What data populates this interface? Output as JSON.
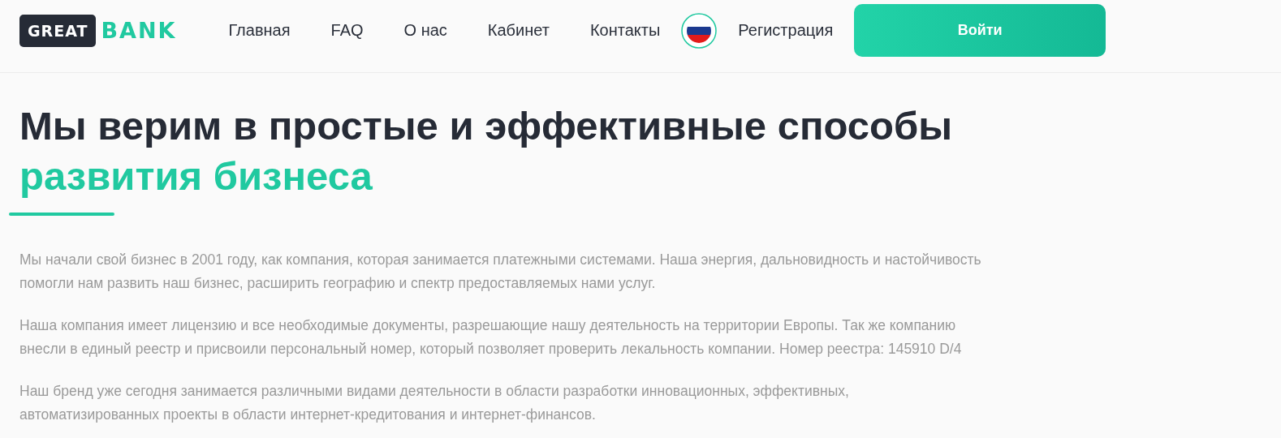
{
  "logo": {
    "part_1": "GREAT",
    "part_2": "BANK"
  },
  "nav": [
    {
      "label": "Главная"
    },
    {
      "label": "FAQ"
    },
    {
      "label": "О нас"
    },
    {
      "label": "Кабинет"
    },
    {
      "label": "Контакты"
    }
  ],
  "register": "Регистрация",
  "login_button": "Войти",
  "heading": {
    "line_1": "Мы верим в простые и эффективные способы",
    "line_2": "развития бизнеса"
  },
  "paragraphs": [
    {
      "lines": [
        "Мы начали свой бизнес в 2001 году, как компания, которая занимается платежными системами. Наша энергия, дальновидность и настойчивость",
        "помогли нам развить наш бизнес, расширить географию и спектр предоставляемых нами услуг."
      ]
    },
    {
      "lines": [
        "Наша компания имеет лицензию и все необходимые документы, разрешающие нашу деятельность на территории Европы. Так же компанию",
        "внесли в единый реестр и присвоили персональный номер, который позволяет проверить лекальность компании. Номер реестра: 145910 D/4"
      ]
    },
    {
      "lines": [
        "Наш бренд уже сегодня занимается различными видами деятельности в области разработки инновационных, эффективных,",
        "автоматизированных проекты в области интернет-кредитования и интернет-финансов."
      ]
    }
  ]
}
